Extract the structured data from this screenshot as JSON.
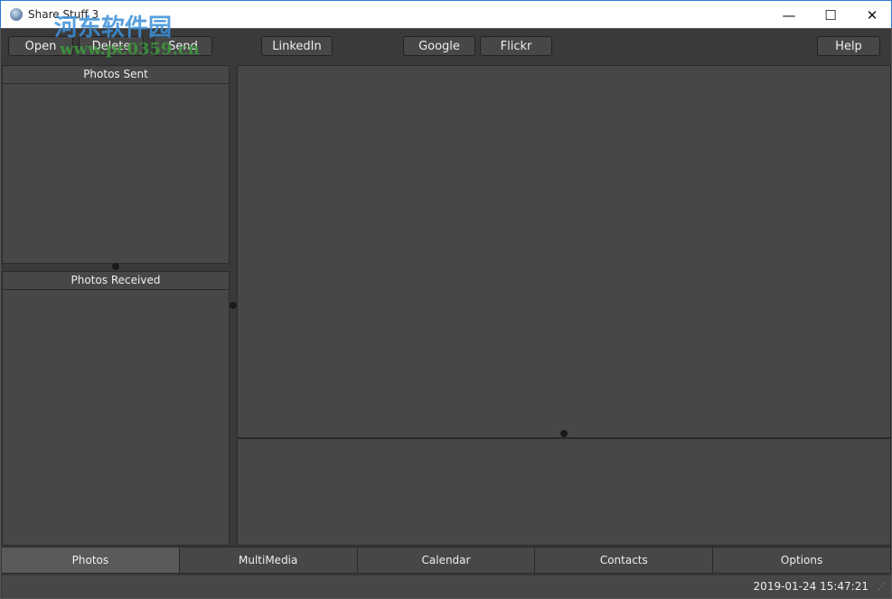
{
  "window": {
    "title": "Share Stuff 3",
    "minimize": "—",
    "maximize": "☐",
    "close": "✕"
  },
  "toolbar": {
    "open": "Open",
    "delete": "Delete",
    "send": "Send",
    "linkedin": "LinkedIn",
    "google": "Google",
    "flickr": "Flickr",
    "help": "Help"
  },
  "left": {
    "sent": "Photos Sent",
    "received": "Photos Received"
  },
  "tabs": [
    "Photos",
    "MultiMedia",
    "Calendar",
    "Contacts",
    "Options"
  ],
  "status": {
    "datetime": "2019-01-24 15:47:21"
  },
  "watermark": {
    "text": "河东软件园",
    "url": "www.pc0359.cn"
  }
}
